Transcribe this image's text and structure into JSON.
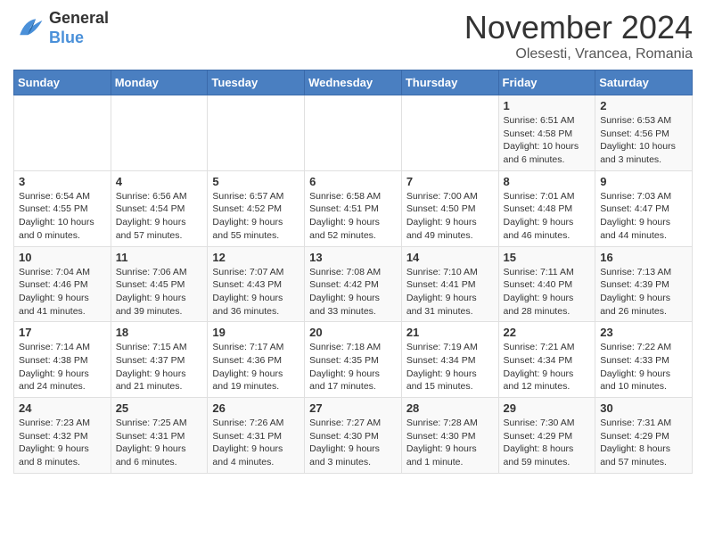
{
  "header": {
    "logo_line1": "General",
    "logo_line2": "Blue",
    "month_title": "November 2024",
    "location": "Olesesti, Vrancea, Romania"
  },
  "weekdays": [
    "Sunday",
    "Monday",
    "Tuesday",
    "Wednesday",
    "Thursday",
    "Friday",
    "Saturday"
  ],
  "weeks": [
    [
      {
        "day": "",
        "info": ""
      },
      {
        "day": "",
        "info": ""
      },
      {
        "day": "",
        "info": ""
      },
      {
        "day": "",
        "info": ""
      },
      {
        "day": "",
        "info": ""
      },
      {
        "day": "1",
        "info": "Sunrise: 6:51 AM\nSunset: 4:58 PM\nDaylight: 10 hours and 6 minutes."
      },
      {
        "day": "2",
        "info": "Sunrise: 6:53 AM\nSunset: 4:56 PM\nDaylight: 10 hours and 3 minutes."
      }
    ],
    [
      {
        "day": "3",
        "info": "Sunrise: 6:54 AM\nSunset: 4:55 PM\nDaylight: 10 hours and 0 minutes."
      },
      {
        "day": "4",
        "info": "Sunrise: 6:56 AM\nSunset: 4:54 PM\nDaylight: 9 hours and 57 minutes."
      },
      {
        "day": "5",
        "info": "Sunrise: 6:57 AM\nSunset: 4:52 PM\nDaylight: 9 hours and 55 minutes."
      },
      {
        "day": "6",
        "info": "Sunrise: 6:58 AM\nSunset: 4:51 PM\nDaylight: 9 hours and 52 minutes."
      },
      {
        "day": "7",
        "info": "Sunrise: 7:00 AM\nSunset: 4:50 PM\nDaylight: 9 hours and 49 minutes."
      },
      {
        "day": "8",
        "info": "Sunrise: 7:01 AM\nSunset: 4:48 PM\nDaylight: 9 hours and 46 minutes."
      },
      {
        "day": "9",
        "info": "Sunrise: 7:03 AM\nSunset: 4:47 PM\nDaylight: 9 hours and 44 minutes."
      }
    ],
    [
      {
        "day": "10",
        "info": "Sunrise: 7:04 AM\nSunset: 4:46 PM\nDaylight: 9 hours and 41 minutes."
      },
      {
        "day": "11",
        "info": "Sunrise: 7:06 AM\nSunset: 4:45 PM\nDaylight: 9 hours and 39 minutes."
      },
      {
        "day": "12",
        "info": "Sunrise: 7:07 AM\nSunset: 4:43 PM\nDaylight: 9 hours and 36 minutes."
      },
      {
        "day": "13",
        "info": "Sunrise: 7:08 AM\nSunset: 4:42 PM\nDaylight: 9 hours and 33 minutes."
      },
      {
        "day": "14",
        "info": "Sunrise: 7:10 AM\nSunset: 4:41 PM\nDaylight: 9 hours and 31 minutes."
      },
      {
        "day": "15",
        "info": "Sunrise: 7:11 AM\nSunset: 4:40 PM\nDaylight: 9 hours and 28 minutes."
      },
      {
        "day": "16",
        "info": "Sunrise: 7:13 AM\nSunset: 4:39 PM\nDaylight: 9 hours and 26 minutes."
      }
    ],
    [
      {
        "day": "17",
        "info": "Sunrise: 7:14 AM\nSunset: 4:38 PM\nDaylight: 9 hours and 24 minutes."
      },
      {
        "day": "18",
        "info": "Sunrise: 7:15 AM\nSunset: 4:37 PM\nDaylight: 9 hours and 21 minutes."
      },
      {
        "day": "19",
        "info": "Sunrise: 7:17 AM\nSunset: 4:36 PM\nDaylight: 9 hours and 19 minutes."
      },
      {
        "day": "20",
        "info": "Sunrise: 7:18 AM\nSunset: 4:35 PM\nDaylight: 9 hours and 17 minutes."
      },
      {
        "day": "21",
        "info": "Sunrise: 7:19 AM\nSunset: 4:34 PM\nDaylight: 9 hours and 15 minutes."
      },
      {
        "day": "22",
        "info": "Sunrise: 7:21 AM\nSunset: 4:34 PM\nDaylight: 9 hours and 12 minutes."
      },
      {
        "day": "23",
        "info": "Sunrise: 7:22 AM\nSunset: 4:33 PM\nDaylight: 9 hours and 10 minutes."
      }
    ],
    [
      {
        "day": "24",
        "info": "Sunrise: 7:23 AM\nSunset: 4:32 PM\nDaylight: 9 hours and 8 minutes."
      },
      {
        "day": "25",
        "info": "Sunrise: 7:25 AM\nSunset: 4:31 PM\nDaylight: 9 hours and 6 minutes."
      },
      {
        "day": "26",
        "info": "Sunrise: 7:26 AM\nSunset: 4:31 PM\nDaylight: 9 hours and 4 minutes."
      },
      {
        "day": "27",
        "info": "Sunrise: 7:27 AM\nSunset: 4:30 PM\nDaylight: 9 hours and 3 minutes."
      },
      {
        "day": "28",
        "info": "Sunrise: 7:28 AM\nSunset: 4:30 PM\nDaylight: 9 hours and 1 minute."
      },
      {
        "day": "29",
        "info": "Sunrise: 7:30 AM\nSunset: 4:29 PM\nDaylight: 8 hours and 59 minutes."
      },
      {
        "day": "30",
        "info": "Sunrise: 7:31 AM\nSunset: 4:29 PM\nDaylight: 8 hours and 57 minutes."
      }
    ]
  ]
}
